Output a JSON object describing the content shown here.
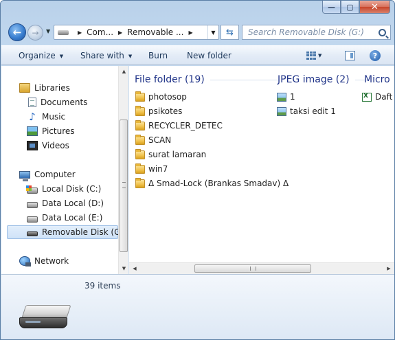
{
  "window": {
    "caption_buttons": {
      "minimize": "—",
      "maximize": "▢",
      "close": "✕"
    }
  },
  "address_bar": {
    "segments": [
      "Com...",
      "Removable ..."
    ],
    "search_placeholder": "Search Removable Disk (G:)"
  },
  "command_bar": {
    "organize": "Organize",
    "share_with": "Share with",
    "burn": "Burn",
    "new_folder": "New folder"
  },
  "nav_pane": {
    "libraries": {
      "label": "Libraries",
      "items": [
        "Documents",
        "Music",
        "Pictures",
        "Videos"
      ]
    },
    "computer": {
      "label": "Computer",
      "items": [
        "Local Disk (C:)",
        "Data Local (D:)",
        "Data Local (E:)",
        "Removable Disk (G:)"
      ],
      "selected": "Removable Disk (G:)"
    },
    "network": {
      "label": "Network"
    }
  },
  "groups": {
    "folders": {
      "header": "File folder (19)",
      "items": [
        "photosop",
        "psikotes",
        "RECYCLER_DETEC",
        "SCAN",
        "surat lamaran",
        "win7",
        "Δ Smad-Lock (Brankas Smadav) Δ"
      ]
    },
    "jpeg": {
      "header": "JPEG image (2)",
      "items": [
        "1",
        "taksi edit 1"
      ]
    },
    "micro": {
      "header": "Micro",
      "items": [
        "Daft"
      ]
    }
  },
  "details": {
    "item_count": "39 items"
  },
  "icons": {
    "back": "back-arrow-icon",
    "forward": "forward-arrow-icon",
    "refresh": "refresh-icon",
    "search": "search-icon",
    "views": "views-icon",
    "preview_pane": "preview-pane-icon",
    "help": "help-icon"
  }
}
